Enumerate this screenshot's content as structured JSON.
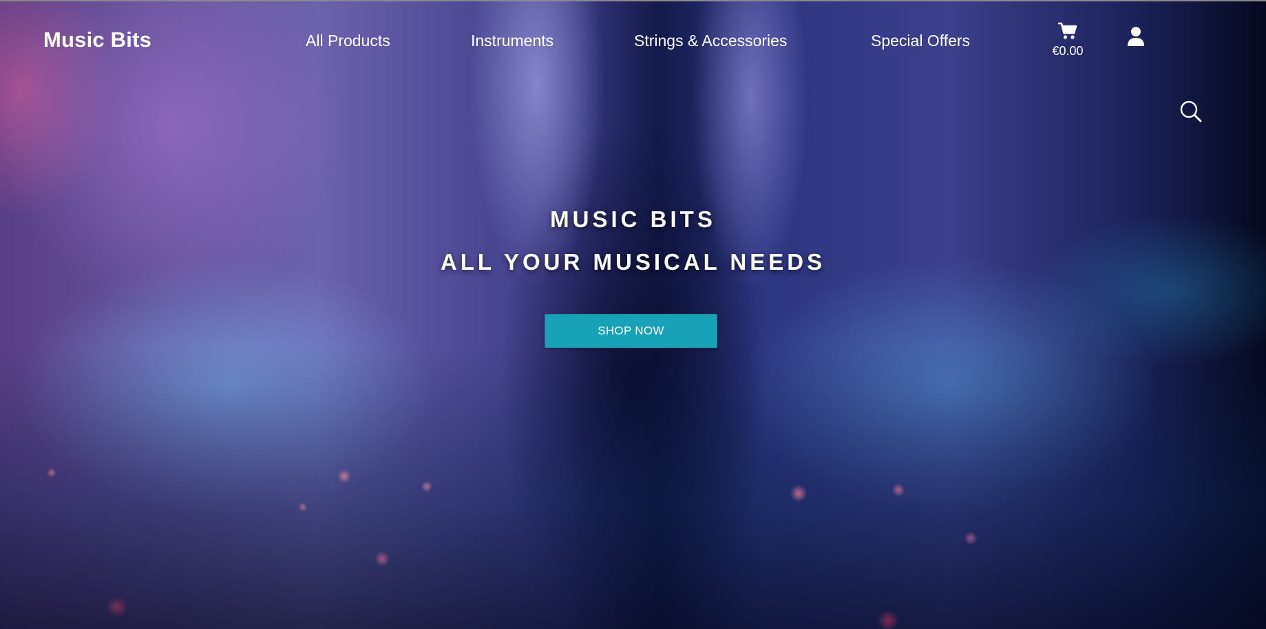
{
  "brand": {
    "name": "Music Bits"
  },
  "nav": {
    "items": [
      {
        "label": "All Products"
      },
      {
        "label": "Instruments"
      },
      {
        "label": "Strings & Accessories"
      },
      {
        "label": "Special Offers"
      }
    ]
  },
  "cart": {
    "icon": "cart-icon",
    "total": "€0.00"
  },
  "account": {
    "icon": "user-icon"
  },
  "search": {
    "icon": "search-icon"
  },
  "hero": {
    "title": "MUSIC BITS",
    "subtitle": "ALL YOUR MUSICAL NEEDS",
    "cta_label": "SHOP NOW"
  },
  "colors": {
    "cta_background": "#17a2b8",
    "text": "#ffffff"
  }
}
